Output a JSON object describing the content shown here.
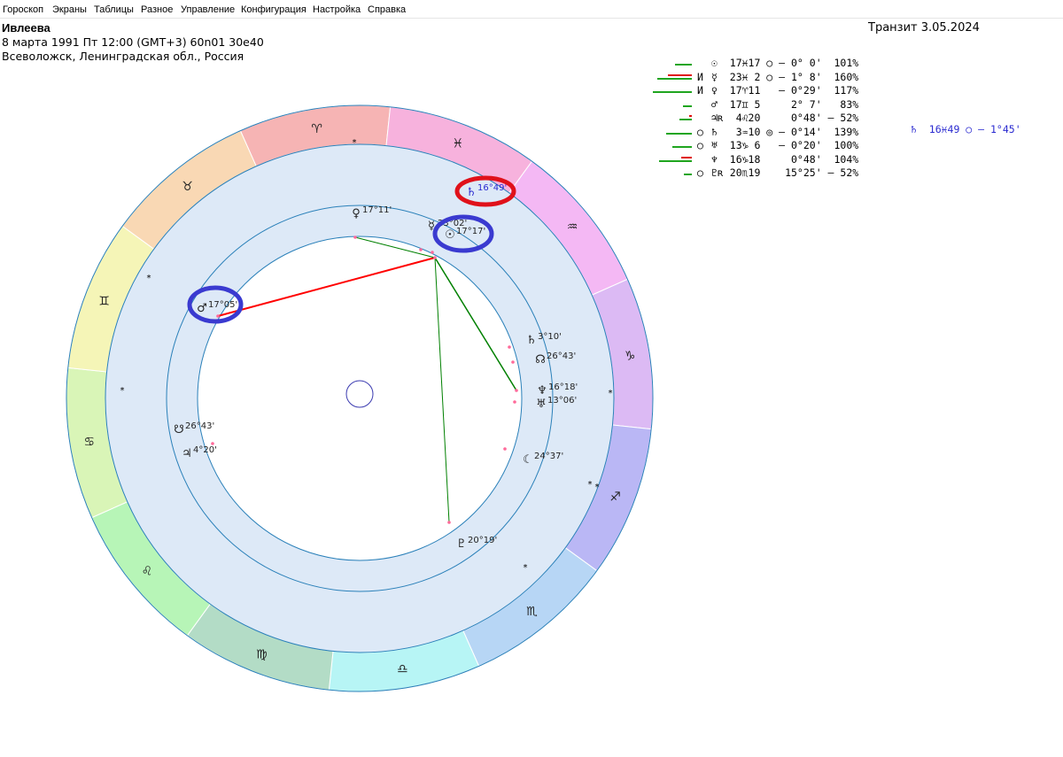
{
  "menu": [
    "Гороскоп",
    "Экраны",
    "Таблицы",
    "Разное",
    "Управление",
    "Конфигурация",
    "Настройка",
    "Справка"
  ],
  "header": {
    "name": "Ивлеева",
    "line1": "8 марта 1991  Пт  12:00 (GMT+3) 60n01  30e40",
    "line2": "Всеволожск, Ленинградская обл., Россия",
    "transit": "Транзит  3.05.2024"
  },
  "aspect_table": [
    {
      "marks": "   ",
      "text": "☉  17♓17 ○ – 0° 0'  101%",
      "bar_green": 19,
      "bar_red": 0
    },
    {
      "marks": "И ",
      "text": "☿  23♓ 2 ○ – 1° 8'  160%",
      "bar_green": 39,
      "bar_red": 27
    },
    {
      "marks": "И ",
      "text": "♀  17♈11   – 0°29'  117%",
      "bar_green": 44,
      "bar_red": 0
    },
    {
      "marks": "   ",
      "text": "♂  17♊ 5     2° 7'   83%",
      "bar_green": 10,
      "bar_red": 0
    },
    {
      "marks": "   ",
      "text": "♃ʀ  4♌20     0°48' – 52%",
      "bar_green": 14,
      "bar_red": 3
    },
    {
      "marks": "○ ",
      "text": "♄   3♒10 ◎ – 0°14'  139%",
      "bar_green": 29,
      "bar_red": 0
    },
    {
      "marks": "○ ",
      "text": "♅  13♑ 6   – 0°20'  100%",
      "bar_green": 22,
      "bar_red": 0
    },
    {
      "marks": "   ",
      "text": "♆  16♑18     0°48'  104%",
      "bar_green": 37,
      "bar_red": 12
    },
    {
      "marks": "○ ",
      "text": "♇ʀ 20♏19    15°25' – 52%",
      "bar_green": 9,
      "bar_red": 0
    }
  ],
  "transit_note": "♄  16♓49 ○ – 1°45'",
  "zodiac_signs": [
    "♈",
    "♓",
    "♒",
    "♑",
    "♐",
    "♏",
    "♎",
    "♍",
    "♌",
    "♋",
    "♊",
    "♉"
  ],
  "natal_planets": [
    {
      "name": "venus",
      "glyph": "♀",
      "label": "17°11'"
    },
    {
      "name": "mercury",
      "glyph": "☿",
      "label": "23°02'"
    },
    {
      "name": "sun",
      "glyph": "☉",
      "label": "17°17'"
    },
    {
      "name": "mars",
      "glyph": "♂",
      "label": "17°05'"
    },
    {
      "name": "saturn",
      "glyph": "♄",
      "label": "3°10'"
    },
    {
      "name": "node",
      "glyph": "☊",
      "label": "26°43'"
    },
    {
      "name": "neptune",
      "glyph": "♆",
      "label": "16°18'"
    },
    {
      "name": "uranus",
      "glyph": "♅",
      "label": "13°06'"
    },
    {
      "name": "lilith",
      "glyph": "☾",
      "label": "24°37'"
    },
    {
      "name": "pluto",
      "glyph": "♇",
      "label": "20°19'"
    },
    {
      "name": "south-node",
      "glyph": "☋",
      "label": "26°43'"
    },
    {
      "name": "jupiter",
      "glyph": "♃",
      "label": "4°20'"
    }
  ],
  "transit_planet": {
    "glyph": "♄",
    "label": "16°49'"
  },
  "colors": {
    "aspect_red": "#ff0000",
    "aspect_green": "#008000",
    "ring": "#dde9f7",
    "circle_line": "#2a80b9",
    "highlight_red": "#e0111a",
    "highlight_blue": "#3a3ad0"
  }
}
